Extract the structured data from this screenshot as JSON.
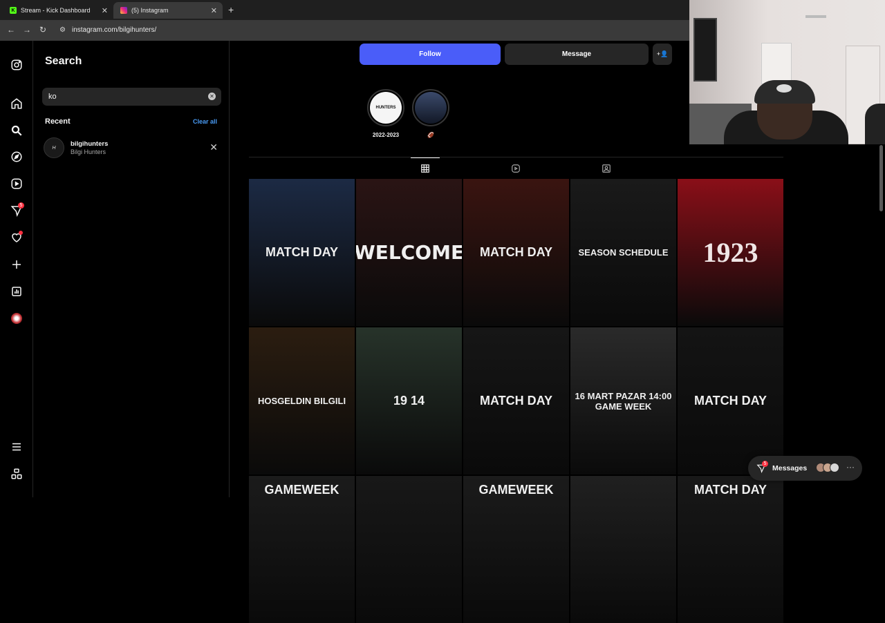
{
  "browser": {
    "tabs": [
      {
        "title": "Stream - Kick Dashboard",
        "favicon": "kick-icon",
        "active": false
      },
      {
        "title": "(5) Instagram",
        "favicon": "instagram-icon",
        "active": true
      }
    ],
    "url": "instagram.com/bilgihunters/"
  },
  "sidebar": {
    "items": [
      {
        "icon": "instagram-logo-icon"
      },
      {
        "icon": "home-icon"
      },
      {
        "icon": "search-icon",
        "active": true
      },
      {
        "icon": "explore-icon"
      },
      {
        "icon": "reels-icon"
      },
      {
        "icon": "messenger-icon",
        "badge": "5"
      },
      {
        "icon": "notifications-heart-icon",
        "dot": true
      },
      {
        "icon": "create-plus-icon"
      },
      {
        "icon": "dashboard-icon"
      },
      {
        "icon": "profile-avatar"
      },
      {
        "icon": "more-menu-icon"
      },
      {
        "icon": "also-from-meta-icon"
      }
    ]
  },
  "search": {
    "title": "Search",
    "value": "ko",
    "recent_label": "Recent",
    "clear_all": "Clear all",
    "recent": [
      {
        "username": "bilgihunters",
        "name": "Bilgi Hunters"
      }
    ]
  },
  "profile": {
    "follow": "Follow",
    "message": "Message",
    "highlights": [
      {
        "label": "2022-2023",
        "cover": "HUNTERS"
      },
      {
        "label": "🏈",
        "cover": "team photo"
      }
    ],
    "tabs": [
      "posts-grid-icon",
      "reels-icon",
      "tagged-icon"
    ]
  },
  "posts": [
    {
      "text": "MATCH DAY",
      "bg": "#1c2a44"
    },
    {
      "text": "WELCOME",
      "bg": "#2a1414"
    },
    {
      "text": "MATCH DAY",
      "bg": "#3a1410"
    },
    {
      "text": "SEASON SCHEDULE",
      "bg": "#1a1a1a"
    },
    {
      "text": "1923",
      "bg": "#8a0f18"
    },
    {
      "text": "HOSGELDIN BILGILI",
      "bg": "#2b1d10"
    },
    {
      "text": "19 14",
      "bg": "#27332a"
    },
    {
      "text": "MATCH DAY",
      "bg": "#161616"
    },
    {
      "text": "16 MART PAZAR 14:00 GAME WEEK",
      "bg": "#2a2a2a"
    },
    {
      "text": "MATCH DAY",
      "bg": "#141414"
    },
    {
      "text": "GAMEWEEK",
      "bg": "#1b1b1b"
    },
    {
      "text": "",
      "bg": "#181818"
    },
    {
      "text": "GAMEWEEK",
      "bg": "#1b1b1b"
    },
    {
      "text": "",
      "bg": "#202020"
    },
    {
      "text": "MATCH DAY",
      "bg": "#181818"
    }
  ],
  "messages": {
    "label": "Messages",
    "badge": "5"
  }
}
